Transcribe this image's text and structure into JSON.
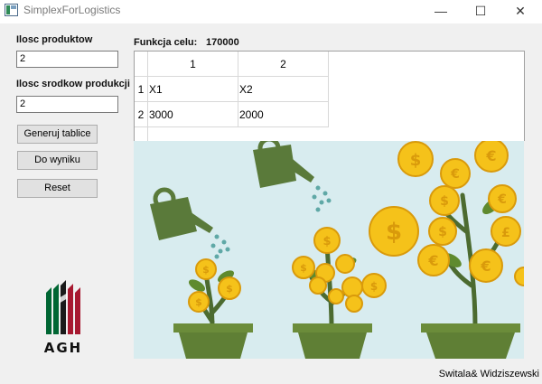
{
  "window": {
    "title": "SimplexForLogistics",
    "controls": {
      "minimize": "—",
      "maximize": "☐",
      "close": "✕"
    }
  },
  "form": {
    "products_label": "Ilosc produktow",
    "products_value": "2",
    "resources_label": "Ilosc srodkow produkcji",
    "resources_value": "2"
  },
  "buttons": {
    "generate": "Generuj tablice",
    "result": "Do wyniku",
    "reset": "Reset"
  },
  "objective": {
    "label": "Funkcja celu:",
    "value": "170000"
  },
  "table": {
    "columns": [
      "1",
      "2"
    ],
    "rows": [
      {
        "header": "1",
        "cells": [
          "X1",
          "X2"
        ]
      },
      {
        "header": "2",
        "cells": [
          "3000",
          "2000"
        ]
      }
    ]
  },
  "logo": {
    "text": "AGH",
    "colors": [
      "#006633",
      "#000000",
      "#a71930"
    ]
  },
  "footer": {
    "credit": "Switala& Widziszewski"
  },
  "illustration": {
    "subject": "watering-cans-money-plants",
    "sky": "#d8ecef",
    "coin": "#f5c21a",
    "plant": "#4c6b30",
    "pot": "#5f7f35"
  }
}
